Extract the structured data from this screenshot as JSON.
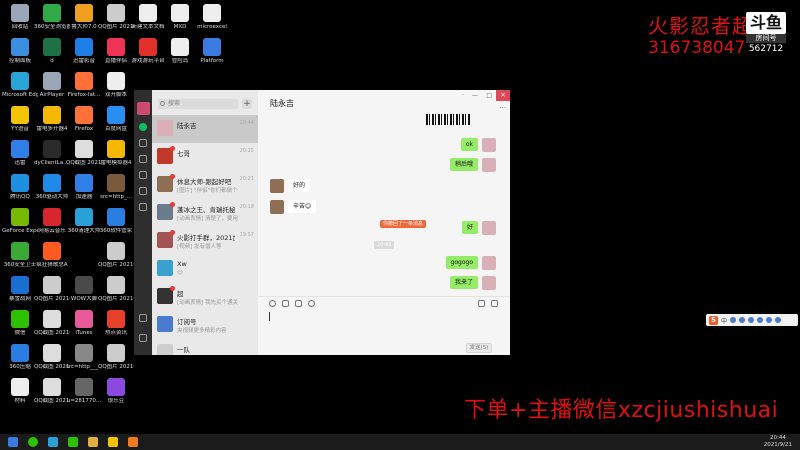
{
  "desktop_icons": [
    {
      "label": "回收站",
      "col": 0,
      "row": 0,
      "color": "#9aa7b8"
    },
    {
      "label": "控制面板",
      "col": 0,
      "row": 1,
      "color": "#3b8ede"
    },
    {
      "label": "Microsoft Edge",
      "col": 0,
      "row": 2,
      "color": "#2aa3d8"
    },
    {
      "label": "YY语音",
      "col": 0,
      "row": 3,
      "color": "#f5c400"
    },
    {
      "label": "迅雷",
      "col": 0,
      "row": 4,
      "color": "#2f7fe6"
    },
    {
      "label": "腾讯QQ",
      "col": 0,
      "row": 5,
      "color": "#1e8fe1"
    },
    {
      "label": "GeForce Experience",
      "col": 0,
      "row": 6,
      "color": "#76b900"
    },
    {
      "label": "360安全卫士",
      "col": 0,
      "row": 7,
      "color": "#3aa935"
    },
    {
      "label": "暴雪战网",
      "col": 0,
      "row": 8,
      "color": "#1b6fd1"
    },
    {
      "label": "微信",
      "col": 0,
      "row": 9,
      "color": "#2dc100"
    },
    {
      "label": "360压缩",
      "col": 0,
      "row": 10,
      "color": "#2a7de1"
    },
    {
      "label": "材料",
      "col": 0,
      "row": 11,
      "color": "#eeeeee"
    },
    {
      "label": "360安全浏览器",
      "col": 1,
      "row": 0,
      "color": "#30a946"
    },
    {
      "label": "d",
      "col": 1,
      "row": 1,
      "color": "#1e7145"
    },
    {
      "label": "AirPlayer",
      "col": 1,
      "row": 2,
      "color": "#9aa7b8"
    },
    {
      "label": "雷电多开器4",
      "col": 1,
      "row": 3,
      "color": "#f5b800"
    },
    {
      "label": "dyClientLa... - 快捷方式",
      "col": 1,
      "row": 4,
      "color": "#2a2a2a"
    },
    {
      "label": "360驱动大师",
      "col": 1,
      "row": 5,
      "color": "#1f8ae8"
    },
    {
      "label": "网易云音乐",
      "col": 1,
      "row": 6,
      "color": "#d8262f"
    },
    {
      "label": "疯狂猜歌总A",
      "col": 1,
      "row": 7,
      "color": "#ff5a1f"
    },
    {
      "label": "QQ图片 20210704...",
      "col": 1,
      "row": 8,
      "color": "#cccccc"
    },
    {
      "label": "QQ截图 20210605...",
      "col": 1,
      "row": 9,
      "color": "#dddddd"
    },
    {
      "label": "QQ截图 20210605...",
      "col": 1,
      "row": 10,
      "color": "#dddddd"
    },
    {
      "label": "QQ截图 20210605...",
      "col": 1,
      "row": 11,
      "color": "#dddddd"
    },
    {
      "label": "鲁大师7.0",
      "col": 2,
      "row": 0,
      "color": "#f0a020"
    },
    {
      "label": "迅雷影音",
      "col": 2,
      "row": 1,
      "color": "#1e7fe6"
    },
    {
      "label": "Firefox-lat...",
      "col": 2,
      "row": 2,
      "color": "#ff7139"
    },
    {
      "label": "Firefox",
      "col": 2,
      "row": 3,
      "color": "#ff7139"
    },
    {
      "label": "QQ截图 20210605...",
      "col": 2,
      "row": 4,
      "color": "#dddddd"
    },
    {
      "label": "加速器",
      "col": 2,
      "row": 5,
      "color": "#2f7fe6"
    },
    {
      "label": "360清理大师",
      "col": 2,
      "row": 6,
      "color": "#2a9fd8"
    },
    {
      "label": "WOW大脚",
      "col": 2,
      "row": 8,
      "color": "#4a4a4a"
    },
    {
      "label": "iTunes",
      "col": 2,
      "row": 9,
      "color": "#e85a9a"
    },
    {
      "label": "src=http___...",
      "col": 2,
      "row": 10,
      "color": "#888888"
    },
    {
      "label": "u=281770...",
      "col": 2,
      "row": 11,
      "color": "#666666"
    },
    {
      "label": "QQ图片 20210719...",
      "col": 3,
      "row": 0,
      "color": "#cccccc"
    },
    {
      "label": "直播伴侣",
      "col": 3,
      "row": 1,
      "color": "#ee3355"
    },
    {
      "label": "双开脚本",
      "col": 3,
      "row": 2,
      "color": "#eeeeee"
    },
    {
      "label": "百度网盘",
      "col": 3,
      "row": 3,
      "color": "#2a8df1"
    },
    {
      "label": "雷电模拟器4",
      "col": 3,
      "row": 4,
      "color": "#f5b800"
    },
    {
      "label": "src=http_...",
      "col": 3,
      "row": 5,
      "color": "#7a5a3a"
    },
    {
      "label": "360软件管家",
      "col": 3,
      "row": 6,
      "color": "#2a7de1"
    },
    {
      "label": "QQ图片 20210719...",
      "col": 3,
      "row": 7,
      "color": "#cccccc"
    },
    {
      "label": "QQ图片 20210719...",
      "col": 3,
      "row": 8,
      "color": "#cccccc"
    },
    {
      "label": "热点资讯",
      "col": 3,
      "row": 9,
      "color": "#e6402a"
    },
    {
      "label": "QQ图片 20210722...",
      "col": 3,
      "row": 10,
      "color": "#cccccc"
    },
    {
      "label": "很乐豆",
      "col": 3,
      "row": 11,
      "color": "#8a4ae0"
    },
    {
      "label": "新建文本文档",
      "col": 4,
      "row": 0,
      "color": "#eeeeee"
    },
    {
      "label": "游戏游玩平台",
      "col": 4,
      "row": 1,
      "color": "#e0302a"
    },
    {
      "label": "MXD",
      "col": 5,
      "row": 0,
      "color": "#eeeeee"
    },
    {
      "label": "冒险岛",
      "col": 5,
      "row": 1,
      "color": "#eeeeee"
    },
    {
      "label": "microexcel",
      "col": 6,
      "row": 0,
      "color": "#eeeeee"
    },
    {
      "label": "Platform",
      "col": 6,
      "row": 1,
      "color": "#3a7be0"
    }
  ],
  "overlay": {
    "streamer_name": "火影忍者超",
    "qq_number": "316738047",
    "room_logo": "斗鱼",
    "room_label": "房间号",
    "room_number": "562712",
    "bottom_text": "下单+主播微信xzcjiushishuai"
  },
  "ime": {
    "logo": "S",
    "mode": "中"
  },
  "wechat": {
    "search_placeholder": "搜索",
    "add_label": "+",
    "conversations": [
      {
        "name": "陆永吉",
        "msg": "",
        "time": "20:44",
        "color": "#d9b0b8",
        "active": true,
        "badge": false
      },
      {
        "name": "七哥",
        "msg": "",
        "time": "20:25",
        "color": "#c0392b",
        "active": false,
        "badge": true
      },
      {
        "name": "休息大师-跟起好吧",
        "msg": "[图片] \"伴侣\"你们都做个",
        "time": "20:21",
        "color": "#8e6f55",
        "active": false,
        "badge": true
      },
      {
        "name": "蓬冰之王、肯瑞托秘...",
        "msg": "[动画表情] 清楚了，要用",
        "time": "20:18",
        "color": "#6a7b8c",
        "active": false,
        "badge": true
      },
      {
        "name": "火影打手群，2021加...",
        "msg": "[视频] 发有偿人等",
        "time": "19:57",
        "color": "#a35454",
        "active": false,
        "badge": true
      },
      {
        "name": "Xw",
        "msg": "😊",
        "time": "",
        "color": "#3aa0d0",
        "active": false,
        "badge": false
      },
      {
        "name": "超",
        "msg": "[动画表情] 我先买个通关",
        "time": "",
        "color": "#333333",
        "active": false,
        "badge": true
      },
      {
        "name": "订阅号",
        "msg": "央视频更多精彩内容",
        "time": "",
        "color": "#4a7bd0",
        "active": false,
        "badge": false
      },
      {
        "name": "一队",
        "msg": "[1条] 请…",
        "time": "",
        "color": "#cfcfcf",
        "active": false,
        "badge": false
      }
    ],
    "chat_title": "陆永吉",
    "win_controls": {
      "min": "—",
      "max": "□",
      "close": "×"
    },
    "more": "···",
    "messages": [
      {
        "side": "me",
        "text": "ok"
      },
      {
        "side": "me",
        "text": "稍后哦"
      },
      {
        "side": "them",
        "text": "好的"
      },
      {
        "side": "them",
        "text": "辛苦😊"
      },
      {
        "side": "me",
        "text": "好"
      },
      {
        "side": "me",
        "text": "gogogo"
      },
      {
        "side": "me",
        "text": "我来了"
      }
    ],
    "system_notice": "你撤回了一条消息",
    "system_time": "20:40",
    "send_label": "发送(S)"
  },
  "taskbar": {
    "time": "20:44",
    "date": "2021/9/21"
  }
}
